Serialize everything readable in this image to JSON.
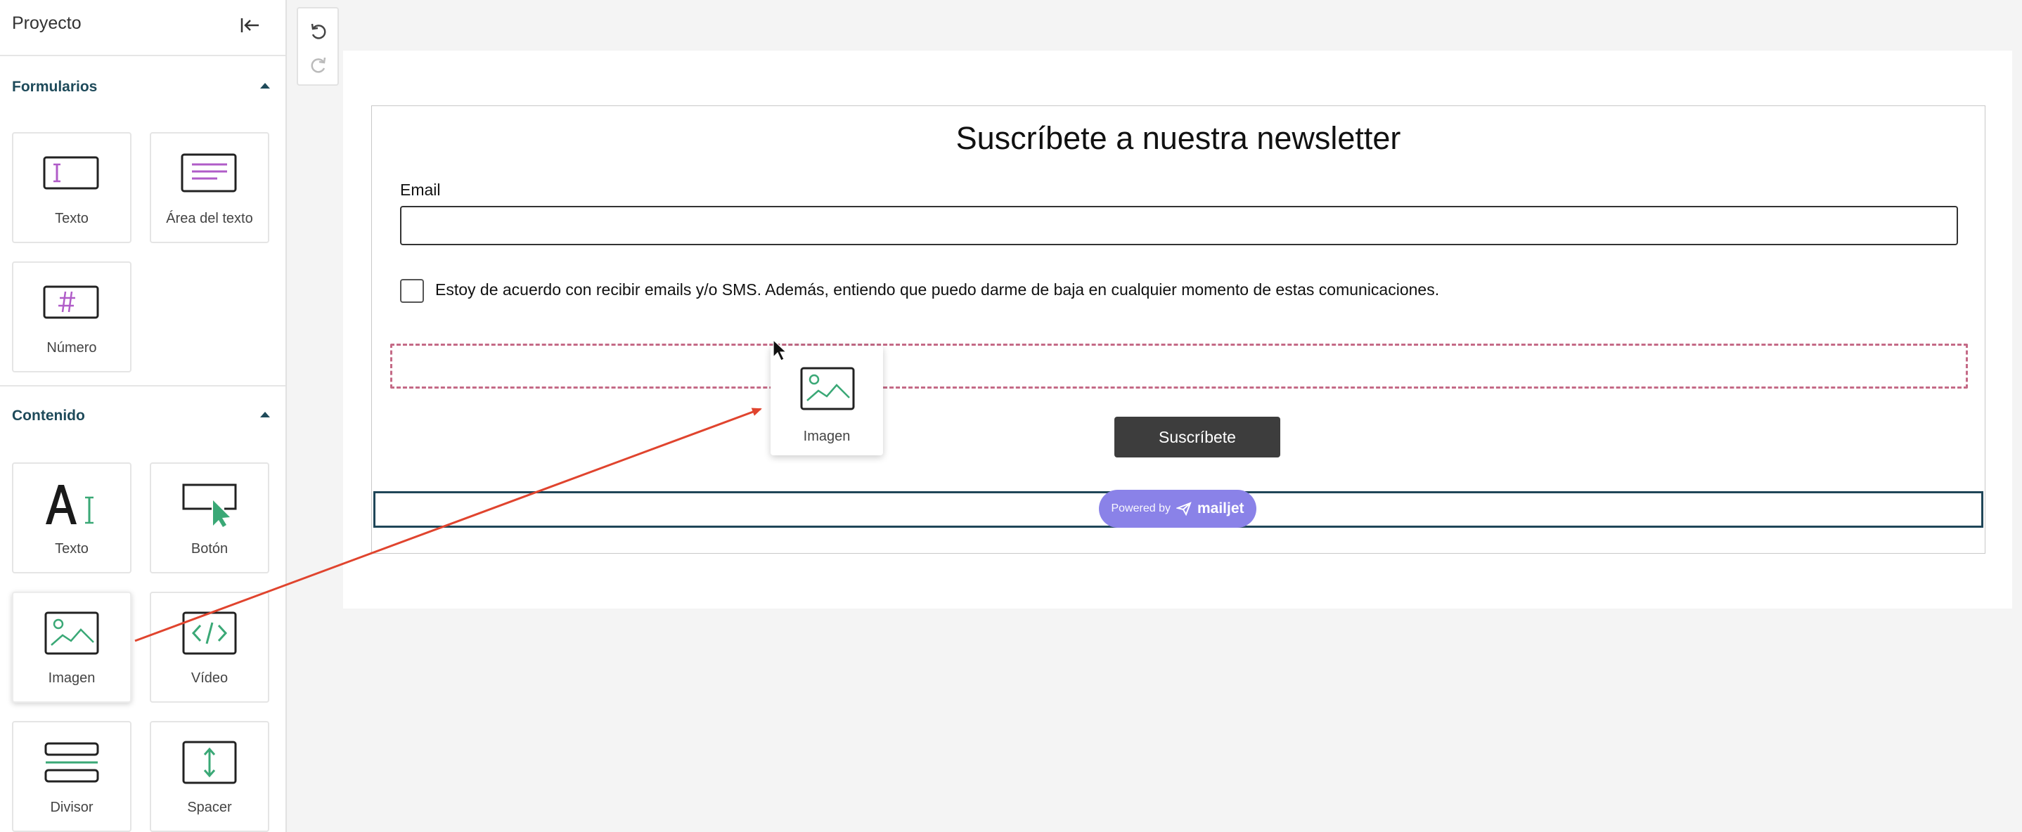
{
  "sidebar": {
    "title": "Proyecto",
    "collapse_icon": "collapse-left-icon",
    "sections": [
      {
        "title": "Formularios",
        "expanded": true,
        "tiles": [
          {
            "label": "Texto",
            "icon": "text-field-icon"
          },
          {
            "label": "Área del texto",
            "icon": "textarea-icon"
          },
          {
            "label": "Número",
            "icon": "number-field-icon"
          }
        ]
      },
      {
        "title": "Contenido",
        "expanded": true,
        "tiles": [
          {
            "label": "Texto",
            "icon": "text-content-icon"
          },
          {
            "label": "Botón",
            "icon": "button-icon"
          },
          {
            "label": "Imagen",
            "icon": "image-icon"
          },
          {
            "label": "Vídeo",
            "icon": "video-icon"
          },
          {
            "label": "Divisor",
            "icon": "divider-icon"
          },
          {
            "label": "Spacer",
            "icon": "spacer-icon"
          }
        ]
      }
    ]
  },
  "toolbar": {
    "undo_icon": "undo-icon",
    "redo_icon": "redo-icon"
  },
  "form": {
    "title": "Suscríbete a nuestra newsletter",
    "email_label": "Email",
    "email_value": "",
    "consent_text": "Estoy de acuerdo con recibir emails y/o SMS. Además, entiendo que puedo darme de baja en cualquier momento de estas comunicaciones.",
    "consent_checked": false,
    "submit_label": "Suscríbete",
    "powered_by": "Powered by",
    "brand": "mailjet"
  },
  "drag_ghost": {
    "label": "Imagen",
    "icon": "image-icon"
  },
  "colors": {
    "accent_dark": "#1e4a5a",
    "form_icon": "#b05cc8",
    "content_icon": "#3aa876",
    "drop_zone": "#c46a86",
    "brand_pill": "#8a82e8",
    "submit_bg": "#3d3d3d",
    "drag_arrow": "#e0442e"
  }
}
